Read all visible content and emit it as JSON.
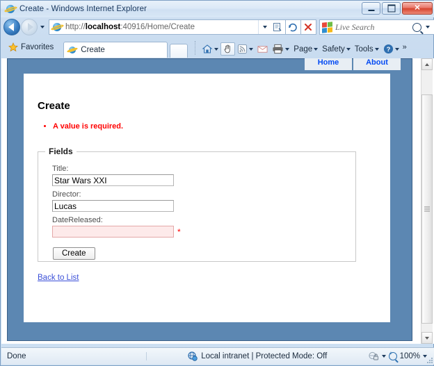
{
  "window": {
    "title": "Create - Windows Internet Explorer",
    "minimize_label": "Minimize",
    "maximize_label": "Maximize",
    "close_label": "Close"
  },
  "addressbar": {
    "url_scheme": "http://",
    "url_host_bold": "localhost",
    "url_rest": ":40916/Home/Create",
    "url_full": "http://localhost:40916/Home/Create",
    "back_label": "Back",
    "forward_label": "Forward",
    "recent_pages_label": "Recent Pages",
    "compatibility_label": "Compatibility View",
    "refresh_label": "Refresh",
    "stop_label": "Stop",
    "stop_glyph": "✕",
    "refresh_glyph": "↺",
    "search_placeholder": "Live Search",
    "search_value": ""
  },
  "tabbar": {
    "favorites_label": "Favorites",
    "tabs": [
      {
        "label": "Create",
        "active": true
      }
    ],
    "new_tab_label": "New Tab"
  },
  "commandbar": {
    "items": [
      {
        "label": "",
        "name": "home-button",
        "glyph": "home",
        "has_caret": true
      },
      {
        "label": "",
        "name": "read-mail-button",
        "glyph": "hand",
        "has_caret": false
      },
      {
        "label": "",
        "name": "feeds-button",
        "glyph": "feed",
        "has_caret": true
      },
      {
        "label": "",
        "name": "read-mail-envelope-button",
        "glyph": "mail",
        "has_caret": false
      },
      {
        "label": "",
        "name": "print-button",
        "glyph": "print",
        "has_caret": true
      },
      {
        "label": "Page",
        "name": "page-menu",
        "glyph": "",
        "has_caret": true
      },
      {
        "label": "Safety",
        "name": "safety-menu",
        "glyph": "",
        "has_caret": true
      },
      {
        "label": "Tools",
        "name": "tools-menu",
        "glyph": "",
        "has_caret": true
      },
      {
        "label": "",
        "name": "help-menu",
        "glyph": "help",
        "has_caret": true
      }
    ],
    "overflow_glyph": "»"
  },
  "page": {
    "nav": [
      {
        "label": "Home"
      },
      {
        "label": "About"
      }
    ],
    "heading": "Create",
    "validation_summary": [
      "A value is required."
    ],
    "fieldset_legend": "Fields",
    "fields": [
      {
        "label": "Title:",
        "value": "Star Wars XXI",
        "placeholder": "",
        "error": false,
        "required_marker": ""
      },
      {
        "label": "Director:",
        "value": "Lucas",
        "placeholder": "",
        "error": false,
        "required_marker": ""
      },
      {
        "label": "DateReleased:",
        "value": "",
        "placeholder": "",
        "error": true,
        "required_marker": "*"
      }
    ],
    "submit_label": "Create",
    "back_link_label": "Back to List"
  },
  "scrollbar": {
    "up_label": "Scroll up",
    "down_label": "Scroll down",
    "thumb_label": "Scroll thumb"
  },
  "statusbar": {
    "status_text": "Done",
    "zone_text": "Local intranet | Protected Mode: Off",
    "zoom_level": "100%"
  },
  "colors": {
    "page_body_blue": "#5c87b2",
    "nav_link_blue": "#034af3",
    "error_red": "#ff0000",
    "error_field_bg": "#fdeaea",
    "link_blue": "#3a4fd8",
    "chrome_blue": "#cfe0f2"
  }
}
